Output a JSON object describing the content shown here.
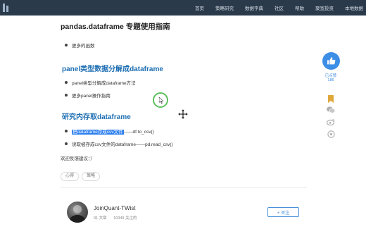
{
  "nav": {
    "items": [
      "首页",
      "策略研究",
      "数据字典",
      "社区",
      "帮助",
      "聚宽投资",
      "本地数据"
    ]
  },
  "article": {
    "title": "pandas.dataframe 专题使用指南",
    "top_item": "更多的函数",
    "section1": {
      "heading": "panel类型数据分解成dataframe",
      "items": [
        "panel类型分解成dataframe方法",
        "更多panel操作指南"
      ]
    },
    "section2": {
      "heading": "研究内存取dataframe",
      "item1_highlight": "把dataframe存成csv文件",
      "item1_rest": "——df.to_csv()",
      "item2": "读取被存成csv文件的dataframe——pd.read_csv()"
    },
    "feedback": "欢迎反馈建议：）",
    "tags": [
      "心得",
      "策略"
    ]
  },
  "author": {
    "name": "JoinQuant-TWist",
    "articles": "91 文章",
    "views": "10349 关注的",
    "follow_label": "+ 关注"
  },
  "sidebar": {
    "like_label": "已点赞",
    "like_count": "186",
    "icons": [
      "bookmark-icon",
      "wechat-icon",
      "weibo-icon",
      "qq-icon"
    ]
  },
  "colors": {
    "nav_bg": "#2b3a4b",
    "heading": "#1f6fb3",
    "accent": "#3d8ee5",
    "highlight": "#2d7ff0",
    "bookmark": "#e0a83a"
  }
}
